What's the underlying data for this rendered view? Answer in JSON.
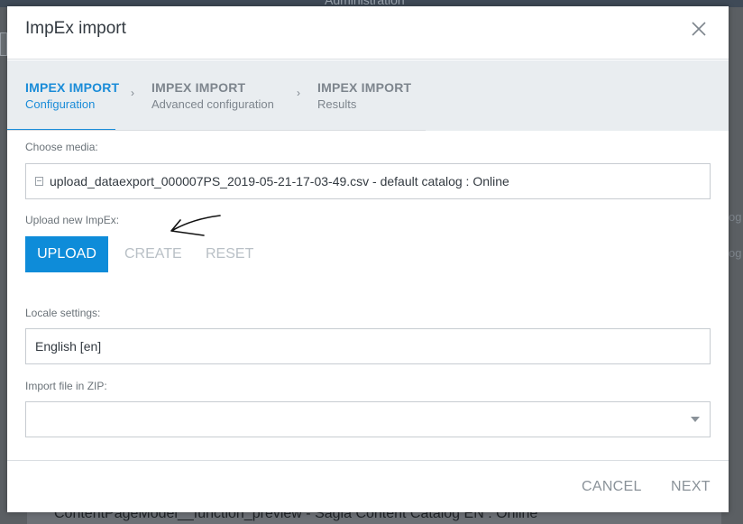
{
  "background": {
    "admin_label": "Administration",
    "right_fragments": [
      "og",
      "og"
    ],
    "bottom_text": "ContentPageModel__function_preview - Sagia Content Catalog EN : Online"
  },
  "modal": {
    "title": "ImpEx import",
    "close_icon": "close-icon",
    "steps": [
      {
        "title": "IMPEX IMPORT",
        "subtitle": "Configuration",
        "active": true
      },
      {
        "title": "IMPEX IMPORT",
        "subtitle": "Advanced configuration",
        "active": false
      },
      {
        "title": "IMPEX IMPORT",
        "subtitle": "Results",
        "active": false
      }
    ],
    "choose_media": {
      "label": "Choose media:",
      "value": "upload_dataexport_000007PS_2019-05-21-17-03-49.csv - default catalog : Online",
      "icon": "file-icon"
    },
    "upload_new": {
      "label": "Upload new ImpEx:",
      "upload_button": "UPLOAD",
      "create_button": "CREATE",
      "reset_button": "RESET"
    },
    "locale": {
      "label": "Locale settings:",
      "value": "English [en]"
    },
    "zip": {
      "label": "Import file in ZIP:",
      "value": ""
    },
    "footer": {
      "cancel_button": "CANCEL",
      "next_button": "NEXT"
    }
  },
  "colors": {
    "accent": "#1a8cd8",
    "upload_bg": "#0e8cd9",
    "disabled_text": "#b9c0c6",
    "stepper_bg": "#e9edf0"
  }
}
